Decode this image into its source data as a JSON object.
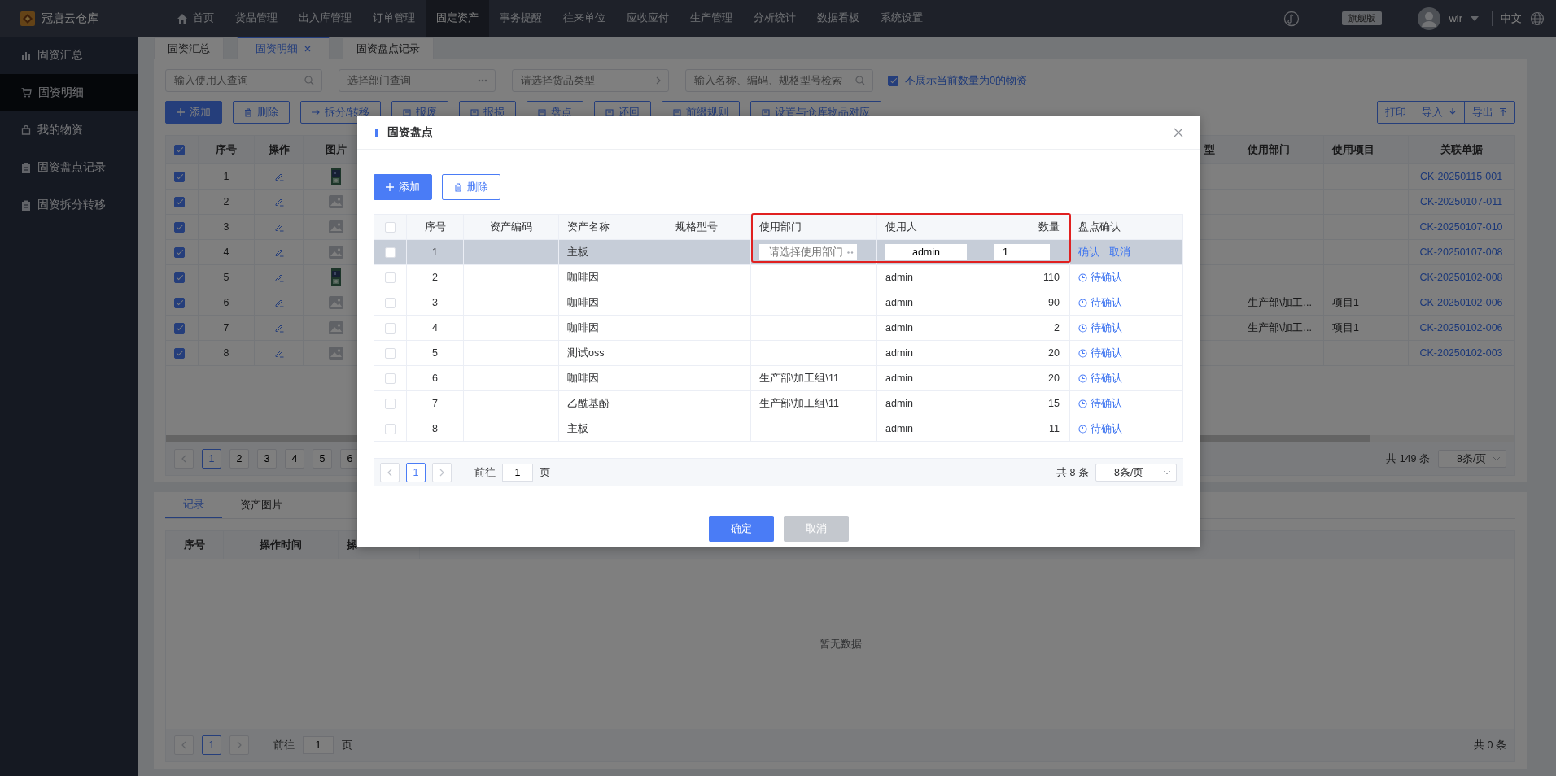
{
  "app": {
    "name": "冠唐云仓库"
  },
  "top_nav": [
    {
      "label": "首页",
      "selected": false
    },
    {
      "label": "货品管理",
      "selected": false
    },
    {
      "label": "出入库管理",
      "selected": false
    },
    {
      "label": "订单管理",
      "selected": false
    },
    {
      "label": "固定资产",
      "selected": true
    },
    {
      "label": "事务提醒",
      "selected": false
    },
    {
      "label": "往来单位",
      "selected": false
    },
    {
      "label": "应收应付",
      "selected": false
    },
    {
      "label": "生产管理",
      "selected": false
    },
    {
      "label": "分析统计",
      "selected": false
    },
    {
      "label": "数据看板",
      "selected": false
    },
    {
      "label": "系统设置",
      "selected": false
    }
  ],
  "header_right": {
    "edition": "旗舰版",
    "user": "wlr",
    "language": "中文"
  },
  "sidebar": {
    "items": [
      {
        "label": "固资汇总",
        "selected": false
      },
      {
        "label": "固资明细",
        "selected": true
      },
      {
        "label": "我的物资",
        "selected": false
      },
      {
        "label": "固资盘点记录",
        "selected": false
      },
      {
        "label": "固资拆分转移",
        "selected": false
      }
    ]
  },
  "page_tabs": [
    {
      "label": "固资汇总",
      "selected": false,
      "closable": false
    },
    {
      "label": "固资明细",
      "selected": true,
      "closable": true
    },
    {
      "label": "固资盘点记录",
      "selected": false,
      "closable": false
    }
  ],
  "filters": {
    "fields": [
      {
        "placeholder": "输入使用人查询",
        "kind": "search"
      },
      {
        "placeholder": "选择部门查询",
        "kind": "more"
      },
      {
        "placeholder": "请选择货品类型",
        "kind": "cascade"
      },
      {
        "placeholder": "输入名称、编码、规格型号检索",
        "kind": "search"
      }
    ],
    "hide_zero": {
      "label": "不展示当前数量为0的物资",
      "checked": true
    }
  },
  "toolbar": [
    {
      "label": "添加",
      "kind": "primary"
    },
    {
      "label": "删除",
      "kind": "plain"
    },
    {
      "label": "拆分/转移",
      "kind": "plain"
    },
    {
      "label": "报废",
      "kind": "plain"
    },
    {
      "label": "报损",
      "kind": "plain"
    },
    {
      "label": "盘点",
      "kind": "plain"
    },
    {
      "label": "还回",
      "kind": "plain"
    },
    {
      "label": "前缀规则",
      "kind": "plain"
    },
    {
      "label": "设置与仓库物品对应",
      "kind": "plain"
    }
  ],
  "toolbar_right": [
    "打印",
    "导入",
    "导出"
  ],
  "table": {
    "all_selected": true,
    "columns": [
      "序号",
      "操作",
      "图片",
      "型",
      "使用部门",
      "使用项目",
      "关联单据"
    ],
    "rows": [
      {
        "selected": true,
        "no": "1",
        "doc": "CK-20250115-001"
      },
      {
        "selected": true,
        "no": "2",
        "kind": "placeholder",
        "doc": "CK-20250107-011"
      },
      {
        "selected": true,
        "no": "3",
        "kind": "placeholder",
        "doc": "CK-20250107-010"
      },
      {
        "selected": true,
        "no": "4",
        "kind": "placeholder",
        "doc": "CK-20250107-008"
      },
      {
        "selected": true,
        "no": "5",
        "doc": "CK-20250102-008"
      },
      {
        "selected": true,
        "no": "6",
        "kind": "placeholder",
        "dept": "生产部\\加工...",
        "project": "项目1",
        "doc": "CK-20250102-006"
      },
      {
        "selected": true,
        "no": "7",
        "kind": "placeholder",
        "dept": "生产部\\加工...",
        "project": "项目1",
        "doc": "CK-20250102-006"
      },
      {
        "selected": true,
        "no": "8",
        "kind": "placeholder",
        "doc": "CK-20250102-003"
      }
    ],
    "pagination": {
      "pages": [
        {
          "label": "1",
          "selected": true
        },
        {
          "label": "2",
          "selected": false
        },
        {
          "label": "3",
          "selected": false
        },
        {
          "label": "4",
          "selected": false
        },
        {
          "label": "5",
          "selected": false
        },
        {
          "label": "6",
          "selected": false
        }
      ],
      "total": "共 149 条",
      "page_size": "8条/页"
    }
  },
  "bottom_panel": {
    "tabs": [
      {
        "label": "记录",
        "selected": true
      },
      {
        "label": "资产图片",
        "selected": false
      }
    ],
    "columns": [
      "序号",
      "操作时间",
      "操"
    ],
    "empty": "暂无数据",
    "pagination": {
      "page": "1",
      "goto_label": "前往",
      "goto_value": "1",
      "goto_unit": "页",
      "total": "共 0 条"
    }
  },
  "dialog": {
    "title": "固资盘点",
    "all_selected": false,
    "buttons": [
      {
        "label": "添加",
        "kind": "primary"
      },
      {
        "label": "删除",
        "kind": "plain"
      }
    ],
    "columns": [
      "序号",
      "资产编码",
      "资产名称",
      "规格型号",
      "使用部门",
      "使用人",
      "数量",
      "盘点确认"
    ],
    "rows": [
      {
        "selected": false,
        "editing": true,
        "no": "1",
        "name": "主板",
        "dept_placeholder": "请选择使用部门",
        "user": "admin",
        "qty": "1",
        "actions": [
          "确认",
          "取消"
        ]
      },
      {
        "selected": false,
        "editing": false,
        "no": "2",
        "name": "咖啡因",
        "user": "admin",
        "qty": "110",
        "status": "待确认"
      },
      {
        "selected": false,
        "editing": false,
        "no": "3",
        "name": "咖啡因",
        "user": "admin",
        "qty": "90",
        "status": "待确认"
      },
      {
        "selected": false,
        "editing": false,
        "no": "4",
        "name": "咖啡因",
        "user": "admin",
        "qty": "2",
        "status": "待确认"
      },
      {
        "selected": false,
        "editing": false,
        "no": "5",
        "name": "测试oss",
        "user": "admin",
        "qty": "20",
        "status": "待确认"
      },
      {
        "selected": false,
        "editing": false,
        "no": "6",
        "name": "咖啡因",
        "dept": "生产部\\加工组\\11",
        "user": "admin",
        "qty": "20",
        "status": "待确认"
      },
      {
        "selected": false,
        "editing": false,
        "no": "7",
        "name": "乙酰基酚",
        "dept": "生产部\\加工组\\11",
        "user": "admin",
        "qty": "15",
        "status": "待确认"
      },
      {
        "selected": false,
        "editing": false,
        "no": "8",
        "name": "主板",
        "user": "admin",
        "qty": "11",
        "status": "待确认"
      }
    ],
    "pagination": {
      "page": "1",
      "goto_label": "前往",
      "goto_value": "1",
      "goto_unit": "页",
      "total": "共 8 条",
      "page_size": "8条/页"
    },
    "footer": [
      {
        "label": "确定",
        "kind": "primary"
      },
      {
        "label": "取消",
        "kind": "disabled"
      }
    ]
  }
}
